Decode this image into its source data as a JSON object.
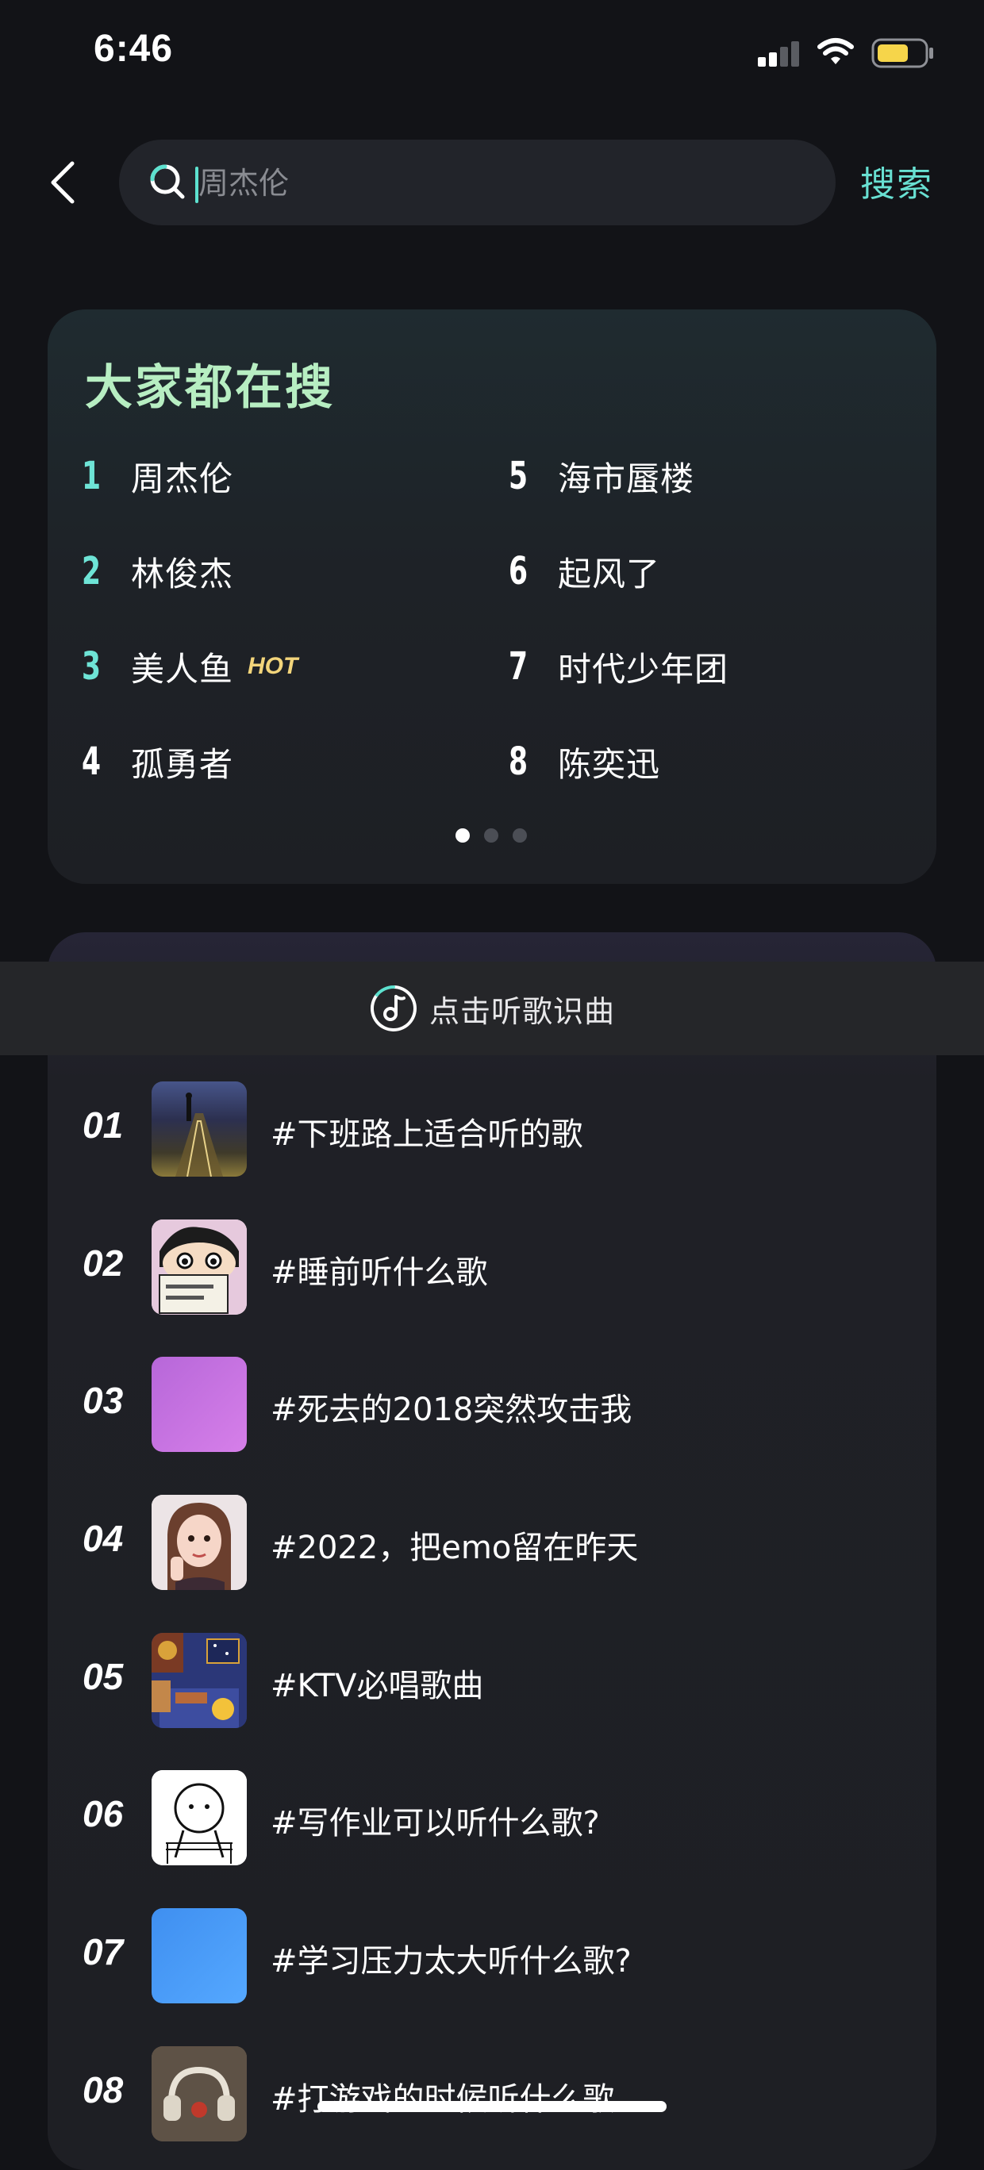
{
  "status_bar": {
    "time": "6:46"
  },
  "header": {
    "search_placeholder": "周杰伦",
    "search_button_label": "搜索"
  },
  "hot_search": {
    "title": "大家都在搜",
    "items": [
      {
        "rank": "1",
        "name": "周杰伦",
        "badge": ""
      },
      {
        "rank": "2",
        "name": "林俊杰",
        "badge": ""
      },
      {
        "rank": "3",
        "name": "美人鱼",
        "badge": "HOT"
      },
      {
        "rank": "4",
        "name": "孤勇者",
        "badge": ""
      },
      {
        "rank": "5",
        "name": "海市蜃楼",
        "badge": ""
      },
      {
        "rank": "6",
        "name": "起风了",
        "badge": ""
      },
      {
        "rank": "7",
        "name": "时代少年团",
        "badge": ""
      },
      {
        "rank": "8",
        "name": "陈奕迅",
        "badge": ""
      }
    ],
    "page_count": 3,
    "active_page": 1
  },
  "recognize": {
    "label": "点击听歌识曲"
  },
  "topics": [
    {
      "rank": "01",
      "label": "#下班路上适合听的歌",
      "thumb": "night-street"
    },
    {
      "rank": "02",
      "label": "#睡前听什么歌",
      "thumb": "cartoon-boy"
    },
    {
      "rank": "03",
      "label": "#死去的2018突然攻击我",
      "thumb": "purple-gradient"
    },
    {
      "rank": "04",
      "label": "#2022，把emo留在昨天",
      "thumb": "girl-portrait"
    },
    {
      "rank": "05",
      "label": "#KTV必唱歌曲",
      "thumb": "illustrated-room"
    },
    {
      "rank": "06",
      "label": "#写作业可以听什么歌?",
      "thumb": "doodle-figure"
    },
    {
      "rank": "07",
      "label": "#学习压力太大听什么歌?",
      "thumb": "blue-gradient"
    },
    {
      "rank": "08",
      "label": "#打游戏的时候听什么歌",
      "thumb": "headphones-photo"
    }
  ],
  "colors": {
    "background": "#121317",
    "accent": "#68e0d2",
    "hot_title": "#b7eec2",
    "hot_badge": "#f3d57b"
  }
}
